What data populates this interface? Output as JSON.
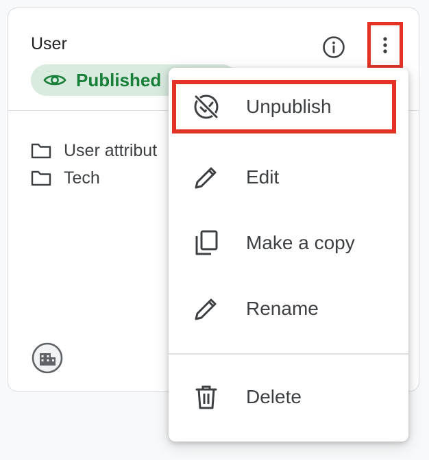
{
  "card": {
    "title": "User",
    "status_badge": {
      "label": "Published",
      "icon": "eye-icon",
      "color": "#188038",
      "background": "#d9eadf"
    },
    "folders": [
      {
        "label": "User attribut",
        "icon": "folder-icon"
      },
      {
        "label": "Tech",
        "icon": "folder-icon"
      }
    ],
    "footer_icon": "building-icon",
    "actions": {
      "info_icon": "info-icon",
      "more_icon": "more-vert-icon"
    }
  },
  "menu": {
    "items": [
      {
        "label": "Unpublish",
        "icon": "unpublish-icon"
      },
      {
        "label": "Edit",
        "icon": "pencil-icon"
      },
      {
        "label": "Make a copy",
        "icon": "copy-icon"
      },
      {
        "label": "Rename",
        "icon": "pencil-icon"
      },
      {
        "label": "Delete",
        "icon": "trash-icon"
      }
    ]
  },
  "colors": {
    "highlight": "#e53224",
    "text": "#3c4043",
    "border": "#dadce0"
  }
}
